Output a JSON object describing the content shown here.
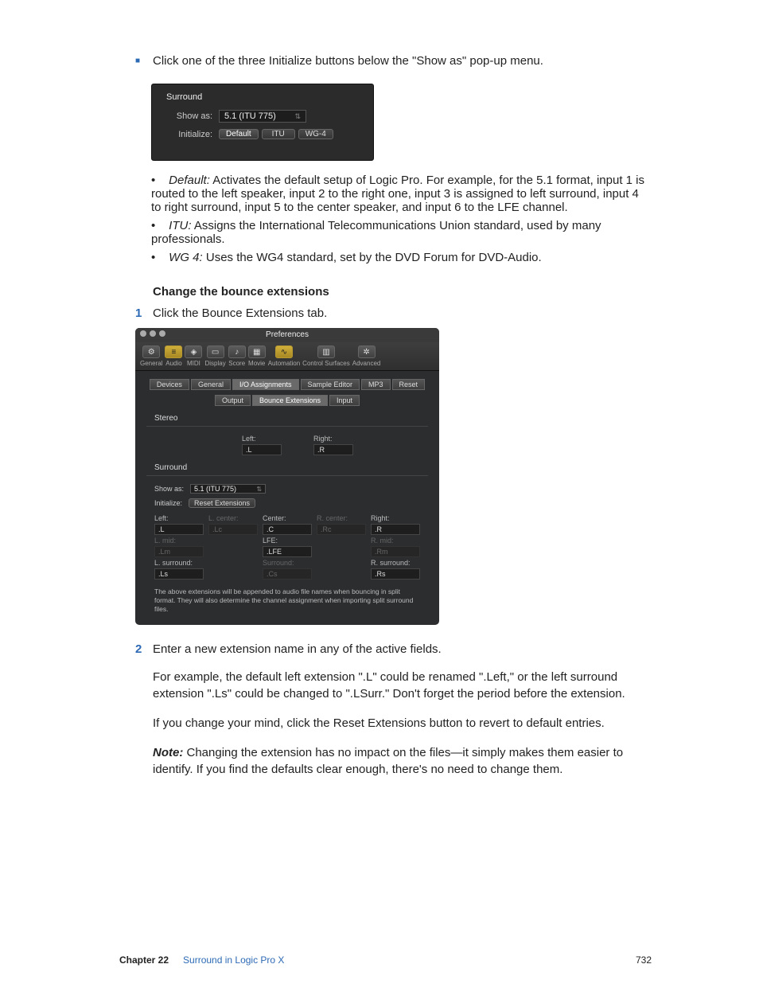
{
  "top_bullet": "Click one of the three Initialize buttons below the \"Show as\" pop-up menu.",
  "panel1": {
    "title": "Surround",
    "show_as_label": "Show as:",
    "show_as_value": "5.1 (ITU 775)",
    "initialize_label": "Initialize:",
    "buttons": {
      "default": "Default",
      "itu": "ITU",
      "wg4": "WG-4"
    }
  },
  "sublist": {
    "default_term": "Default:",
    "default_text": " Activates the default setup of Logic Pro. For example, for the 5.1 format, input 1 is routed to the left speaker, input 2 to the right one, input 3 is assigned to left surround, input 4 to right surround, input 5 to the center speaker, and input 6 to the LFE channel.",
    "itu_term": "ITU:",
    "itu_text": " Assigns the International Telecommunications Union standard, used by many professionals.",
    "wg4_term": "WG 4:",
    "wg4_text": " Uses the WG4 standard, set by the DVD Forum for DVD-Audio."
  },
  "subheading": "Change the bounce extensions",
  "step1": "Click the Bounce Extensions tab.",
  "step2": "Enter a new extension name in any of the active fields.",
  "para1": "For example, the default left extension \".L\" could be renamed \".Left,\" or the left surround extension \".Ls\" could be changed to \".LSurr.\" Don't forget the period before the extension.",
  "para2": "If you change your mind, click the Reset Extensions button to revert to default entries.",
  "note_label": "Note:",
  "note_text": "  Changing the extension has no impact on the files—it simply makes them easier to identify. If you find the defaults clear enough, there's no need to change them.",
  "prefs": {
    "window_title": "Preferences",
    "toolbar": [
      "General",
      "Audio",
      "MIDI",
      "Display",
      "Score",
      "Movie",
      "Automation",
      "Control Surfaces",
      "Advanced"
    ],
    "tabs1": [
      "Devices",
      "General",
      "I/O Assignments",
      "Sample Editor",
      "MP3",
      "Reset"
    ],
    "tabs2": [
      "Output",
      "Bounce Extensions",
      "Input"
    ],
    "stereo_title": "Stereo",
    "stereo": {
      "left_lbl": "Left:",
      "left_val": ".L",
      "right_lbl": "Right:",
      "right_val": ".R"
    },
    "surround_title": "Surround",
    "show_as_label": "Show as:",
    "show_as_value": "5.1 (ITU 775)",
    "initialize_label": "Initialize:",
    "reset_btn": "Reset Extensions",
    "grid": {
      "r1": {
        "left_l": "Left:",
        "lcenter_l": "L. center:",
        "center_l": "Center:",
        "rcenter_l": "R. center:",
        "right_l": "Right:",
        "left_v": ".L",
        "lcenter_v": ".Lc",
        "center_v": ".C",
        "rcenter_v": ".Rc",
        "right_v": ".R"
      },
      "r2": {
        "lmid_l": "L. mid:",
        "lfe_l": "LFE:",
        "rmid_l": "R. mid:",
        "lmid_v": ".Lm",
        "lfe_v": ".LFE",
        "rmid_v": ".Rm"
      },
      "r3": {
        "lsur_l": "L. surround:",
        "sur_l": "Surround:",
        "rsur_l": "R. surround:",
        "lsur_v": ".Ls",
        "sur_v": ".Cs",
        "rsur_v": ".Rs"
      }
    },
    "footnote": "The above extensions will be appended to audio file names when bouncing in split format. They will also determine the channel assignment when importing split surround files."
  },
  "footer": {
    "chapter": "Chapter  22",
    "title": "Surround in Logic Pro X",
    "page": "732"
  }
}
